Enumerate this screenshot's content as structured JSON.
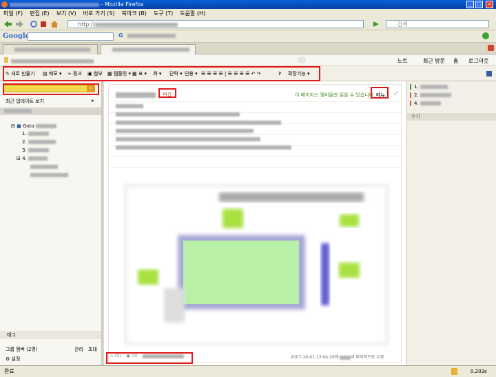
{
  "window": {
    "title": "- Mozilla Firefox",
    "buttons": [
      "_",
      "□",
      "×"
    ]
  },
  "menu": [
    "파일 (F)",
    "편집 (E)",
    "보기 (V)",
    "바로 가기 (S)",
    "북마크 (B)",
    "도구 (T)",
    "도움말 (H)"
  ],
  "nav": {
    "url": "http://",
    "search_placeholder": "검색"
  },
  "google": {
    "logo": "Google",
    "search_value": "",
    "buttons": [
      "G",
      "·"
    ]
  },
  "appbar": {
    "right_items": [
      "노트",
      "최근 방문",
      "홈",
      "로그아웃"
    ]
  },
  "toolbar": {
    "new_page": "새로 만들기",
    "memo": "메모",
    "link": "링크",
    "attach": "첨부",
    "template": "템플릿",
    "table": "표",
    "font": "가",
    "paragraph": "단락",
    "quote": "인용",
    "help": "?",
    "more": "확장기능"
  },
  "sidebar": {
    "recent": "최근 업데이트 보기",
    "tree_root": "Goto",
    "tree_items": [
      "1.",
      "2.",
      "3.",
      "4."
    ],
    "tag_header": "태그",
    "group": "그룹 멤버 (2명)",
    "group_manage": "관리",
    "group_invite": "초대",
    "settings": "설정"
  },
  "content": {
    "edit_link": "편집",
    "notice": "이 페이지는 멤버들만 읽을 수 있습니다.",
    "menu_button": "메뉴",
    "footer_comments": "(0)",
    "footer_files": "(0)",
    "footer_date": "2007-10-01 13:04:20에",
    "footer_last_edit": "이 마지막으로 수정"
  },
  "rightpanel": {
    "items": [
      "1.",
      "2.",
      "4."
    ],
    "section": "수기"
  },
  "status": {
    "text": "완료",
    "timer": "0.203s"
  }
}
